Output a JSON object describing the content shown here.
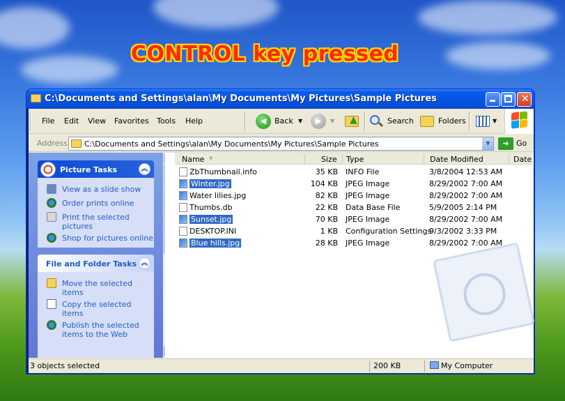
{
  "banner": "CONTROL key pressed",
  "window": {
    "title": "C:\\Documents and Settings\\alan\\My Documents\\My Pictures\\Sample Pictures"
  },
  "menu": [
    "File",
    "Edit",
    "View",
    "Favorites",
    "Tools",
    "Help"
  ],
  "toolbar": {
    "back": "Back",
    "search": "Search",
    "folders": "Folders"
  },
  "address": {
    "label": "Address",
    "value": "C:\\Documents and Settings\\alan\\My Documents\\My Pictures\\Sample Pictures",
    "go": "Go"
  },
  "picture_tasks": {
    "title": "Picture Tasks",
    "items": [
      "View as a slide show",
      "Order prints online",
      "Print the selected pictures",
      "Shop for pictures online"
    ]
  },
  "file_tasks": {
    "title": "File and Folder Tasks",
    "items": [
      "Move the selected items",
      "Copy the selected items",
      "Publish the selected items to the Web"
    ]
  },
  "columns": [
    "Name",
    "Size",
    "Type",
    "Date Modified",
    "Date"
  ],
  "files": [
    {
      "name": "ZbThumbnail.info",
      "size": "35 KB",
      "type": "INFO File",
      "date": "3/8/2004 12:53 AM",
      "selected": false
    },
    {
      "name": "Winter.jpg",
      "size": "104 KB",
      "type": "JPEG Image",
      "date": "8/29/2002 7:00 AM",
      "selected": true
    },
    {
      "name": "Water lilies.jpg",
      "size": "82 KB",
      "type": "JPEG Image",
      "date": "8/29/2002 7:00 AM",
      "selected": false
    },
    {
      "name": "Thumbs.db",
      "size": "22 KB",
      "type": "Data Base File",
      "date": "5/9/2005 2:14 PM",
      "selected": false
    },
    {
      "name": "Sunset.jpg",
      "size": "70 KB",
      "type": "JPEG Image",
      "date": "8/29/2002 7:00 AM",
      "selected": true
    },
    {
      "name": "DESKTOP.INI",
      "size": "1 KB",
      "type": "Configuration Settings",
      "date": "9/3/2002 3:33 PM",
      "selected": false
    },
    {
      "name": "Blue hills.jpg",
      "size": "28 KB",
      "type": "JPEG Image",
      "date": "8/29/2002 7:00 AM",
      "selected": true
    }
  ],
  "status": {
    "objects": "3 objects selected",
    "size": "200 KB",
    "location": "My Computer"
  }
}
